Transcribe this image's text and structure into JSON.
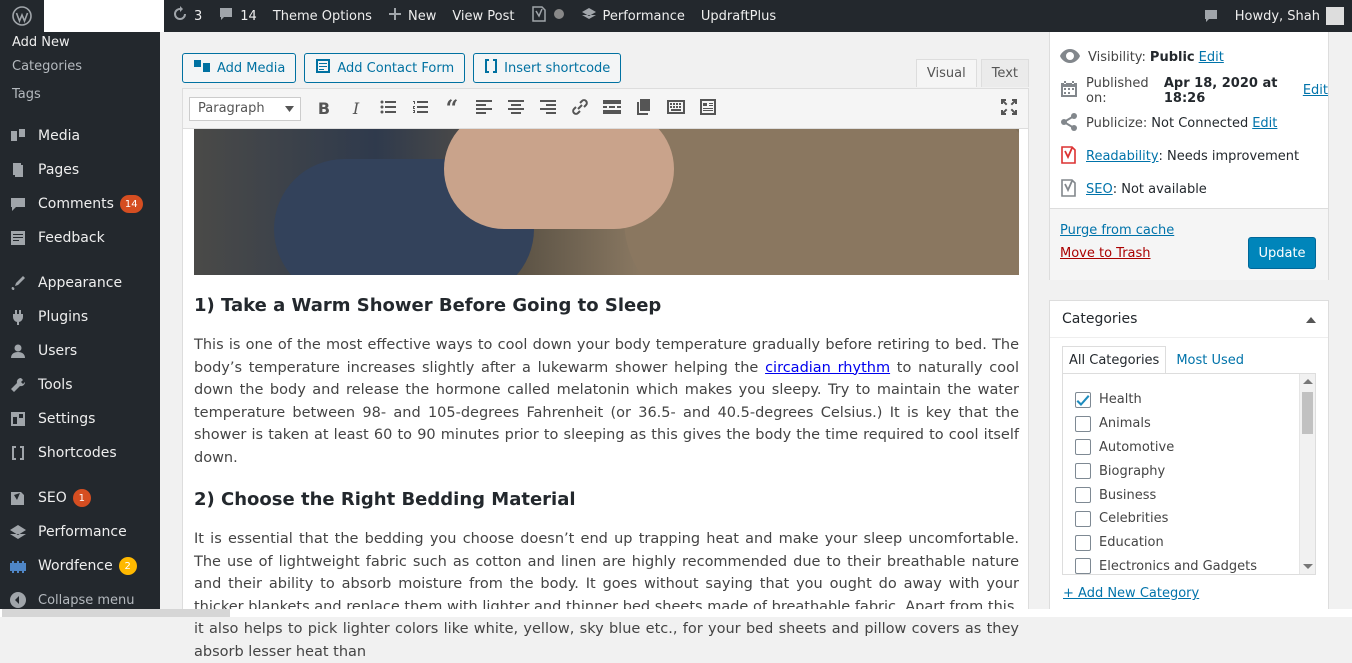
{
  "adminbar": {
    "updates_count": "3",
    "comments_count": "14",
    "theme_options": "Theme Options",
    "new_label": "New",
    "view_post": "View Post",
    "performance": "Performance",
    "updraft": "UpdraftPlus",
    "howdy": "Howdy, Shah"
  },
  "sidebar": {
    "sub_items": [
      "Add New",
      "Categories",
      "Tags"
    ],
    "items": [
      {
        "label": "Media",
        "icon": "media-icon"
      },
      {
        "label": "Pages",
        "icon": "pages-icon"
      },
      {
        "label": "Comments",
        "icon": "comments-icon",
        "badge": "14"
      },
      {
        "label": "Feedback",
        "icon": "feedback-icon"
      },
      {
        "label": "Appearance",
        "icon": "appearance-icon"
      },
      {
        "label": "Plugins",
        "icon": "plugins-icon"
      },
      {
        "label": "Users",
        "icon": "users-icon"
      },
      {
        "label": "Tools",
        "icon": "tools-icon"
      },
      {
        "label": "Settings",
        "icon": "settings-icon"
      },
      {
        "label": "Shortcodes",
        "icon": "shortcodes-icon"
      },
      {
        "label": "SEO",
        "icon": "seo-icon",
        "badge": "1"
      },
      {
        "label": "Performance",
        "icon": "performance-icon"
      },
      {
        "label": "Wordfence",
        "icon": "wordfence-icon",
        "badge": "2"
      },
      {
        "label": "Collapse menu",
        "icon": "collapse-icon"
      }
    ]
  },
  "editor": {
    "add_media": "Add Media",
    "add_contact_form": "Add Contact Form",
    "insert_shortcode": "Insert shortcode",
    "tab_visual": "Visual",
    "tab_text": "Text",
    "format_select": "Paragraph",
    "heading1": "1) Take a Warm Shower Before Going to Sleep",
    "para1_a": "This is one of the most effective ways to cool down your body temperature gradually before retiring to bed. The body’s temperature increases slightly after a lukewarm shower helping the ",
    "para1_link": "circadian rhythm",
    "para1_b": " to naturally cool down the body and release the hormone called melatonin which makes you sleepy. Try to maintain the water temperature between 98- and 105-degrees Fahrenheit (or 36.5- and 40.5-degrees Celsius.) It is key that the shower is taken at least 60 to 90 minutes prior to sleeping as this gives the body the time required to cool itself down.",
    "heading2": "2) Choose the Right Bedding Material",
    "para2": "It is essential that the bedding you choose doesn’t end up trapping heat and make your sleep uncomfortable. The use of lightweight fabric such as cotton and linen are highly recommended due to their breathable nature and their ability to absorb moisture from the body. It goes without saying that you ought do away with your thicker blankets and replace them with lighter and thinner bed sheets made of breathable fabric. Apart from this, it also helps to pick lighter colors like white, yellow, sky blue etc., for your bed sheets and pillow covers as they absorb lesser heat than"
  },
  "publish": {
    "visibility_label": "Visibility:",
    "visibility_value": "Public",
    "edit": "Edit",
    "published_label": "Published on:",
    "published_value": "Apr 18, 2020 at 18:26",
    "publicize_label": "Publicize:",
    "publicize_value": "Not Connected",
    "readability_label": "Readability",
    "readability_value": ": Needs improvement",
    "seo_label": "SEO",
    "seo_value": ": Not available",
    "purge": "Purge from cache",
    "trash": "Move to Trash",
    "update": "Update"
  },
  "categories": {
    "title": "Categories",
    "tab_all": "All Categories",
    "tab_used": "Most Used",
    "items": [
      {
        "label": "Health",
        "checked": true
      },
      {
        "label": "Animals",
        "checked": false
      },
      {
        "label": "Automotive",
        "checked": false
      },
      {
        "label": "Biography",
        "checked": false
      },
      {
        "label": "Business",
        "checked": false
      },
      {
        "label": "Celebrities",
        "checked": false
      },
      {
        "label": "Education",
        "checked": false
      },
      {
        "label": "Electronics and Gadgets",
        "checked": false
      }
    ],
    "add_new": "+ Add New Category"
  },
  "colors": {
    "primary": "#0085ba",
    "sidebar": "#23282d",
    "badge": "#d54e21",
    "badge_yellow": "#ffb900"
  }
}
